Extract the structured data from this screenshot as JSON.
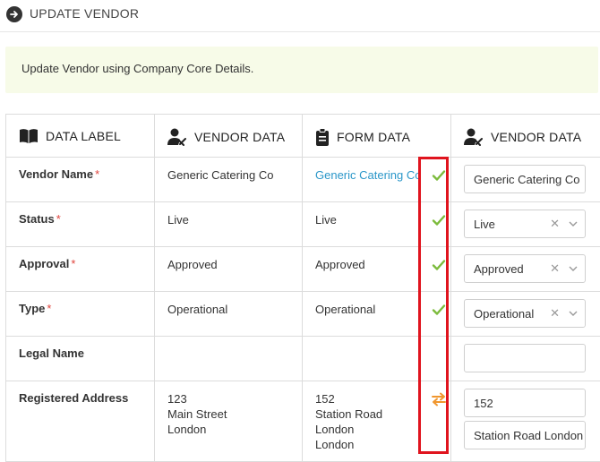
{
  "header": {
    "title": "UPDATE VENDOR"
  },
  "banner": {
    "text": "Update Vendor using Company Core Details."
  },
  "columns": {
    "label": "DATA LABEL",
    "vendor": "VENDOR DATA",
    "form": "FORM DATA",
    "vendor_edit": "VENDOR DATA"
  },
  "rows": [
    {
      "label": "Vendor Name",
      "required": "*",
      "vendor": "Generic Catering Co",
      "form": "Generic Catering Co",
      "status": "match",
      "field": "Generic Catering Co"
    },
    {
      "label": "Status",
      "required": "*",
      "vendor": "Live",
      "form": "Live",
      "status": "match",
      "field": "Live"
    },
    {
      "label": "Approval",
      "required": "*",
      "vendor": "Approved",
      "form": "Approved",
      "status": "match",
      "field": "Approved"
    },
    {
      "label": "Type",
      "required": "*",
      "vendor": "Operational",
      "form": "Operational",
      "status": "match",
      "field": "Operational"
    },
    {
      "label": "Legal Name",
      "vendor": "",
      "form": "",
      "field": ""
    },
    {
      "label": "Registered Address",
      "vendor_lines": [
        "123",
        "Main Street",
        "London"
      ],
      "form_lines": [
        "152",
        "Station Road",
        "London",
        "London"
      ],
      "status": "differ",
      "field_lines": [
        "152",
        "Station Road London"
      ]
    }
  ],
  "icons": {
    "header": "arrow-circle-right-icon",
    "label": "book-icon",
    "vendor": "user-edit-icon",
    "form": "clipboard-icon",
    "match": "check-icon",
    "differ": "swap-arrows-icon"
  },
  "colors": {
    "check": "#7cbb3c",
    "swap": "#f0962e",
    "highlight": "#e0141e",
    "link": "#2b97c9",
    "required": "#e0443d"
  }
}
